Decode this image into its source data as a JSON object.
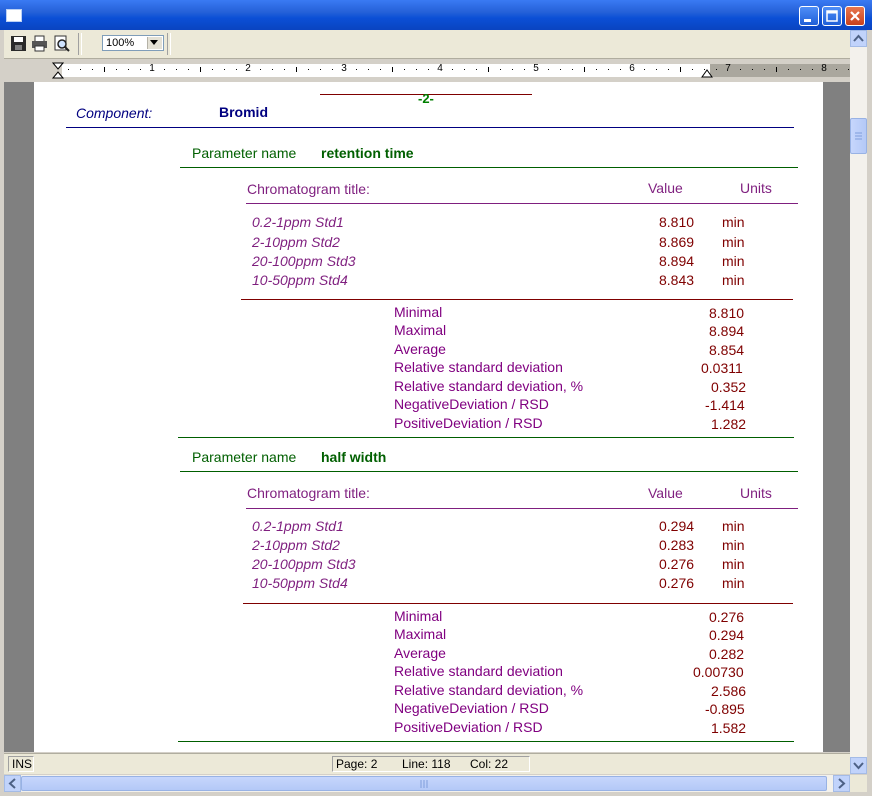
{
  "toolbar": {
    "zoom_value": "100%"
  },
  "ruler": {
    "numbers": [
      "1",
      "2",
      "3",
      "4",
      "5",
      "6",
      "7",
      "8"
    ]
  },
  "document": {
    "page_number": "-2-",
    "component_label": "Component:",
    "component_value": "Bromid",
    "sections": [
      {
        "param_label": "Parameter name",
        "param_value": "retention time",
        "header": {
          "title": "Chromatogram title:",
          "value": "Value",
          "units": "Units"
        },
        "rows": [
          {
            "name": "0.2-1ppm Std1",
            "value": "8.810",
            "unit": "min"
          },
          {
            "name": "2-10ppm Std2",
            "value": "8.869",
            "unit": "min"
          },
          {
            "name": "20-100ppm Std3",
            "value": "8.894",
            "unit": "min"
          },
          {
            "name": "10-50ppm Std4",
            "value": "8.843",
            "unit": "min"
          }
        ],
        "stats": [
          {
            "label": "Minimal",
            "value": "8.810"
          },
          {
            "label": "Maximal",
            "value": "8.894"
          },
          {
            "label": "Average",
            "value": "8.854"
          },
          {
            "label": "Relative standard deviation",
            "value": "0.0311"
          },
          {
            "label": "Relative standard deviation, %",
            "value": "0.352"
          },
          {
            "label": "NegativeDeviation / RSD",
            "value": "-1.414"
          },
          {
            "label": "PositiveDeviation / RSD",
            "value": "1.282"
          }
        ]
      },
      {
        "param_label": "Parameter name",
        "param_value": "half width",
        "header": {
          "title": "Chromatogram title:",
          "value": "Value",
          "units": "Units"
        },
        "rows": [
          {
            "name": "0.2-1ppm Std1",
            "value": "0.294",
            "unit": "min"
          },
          {
            "name": "2-10ppm Std2",
            "value": "0.283",
            "unit": "min"
          },
          {
            "name": "20-100ppm Std3",
            "value": "0.276",
            "unit": "min"
          },
          {
            "name": "10-50ppm Std4",
            "value": "0.276",
            "unit": "min"
          }
        ],
        "stats": [
          {
            "label": "Minimal",
            "value": "0.276"
          },
          {
            "label": "Maximal",
            "value": "0.294"
          },
          {
            "label": "Average",
            "value": "0.282"
          },
          {
            "label": "Relative standard deviation",
            "value": "0.00730"
          },
          {
            "label": "Relative standard deviation, %",
            "value": "2.586"
          },
          {
            "label": "NegativeDeviation / RSD",
            "value": "-0.895"
          },
          {
            "label": "PositiveDeviation / RSD",
            "value": "1.582"
          }
        ]
      }
    ]
  },
  "statusbar": {
    "mode": "INS",
    "page": "Page: 2",
    "line": "Line: 118",
    "col": "Col: 22"
  }
}
